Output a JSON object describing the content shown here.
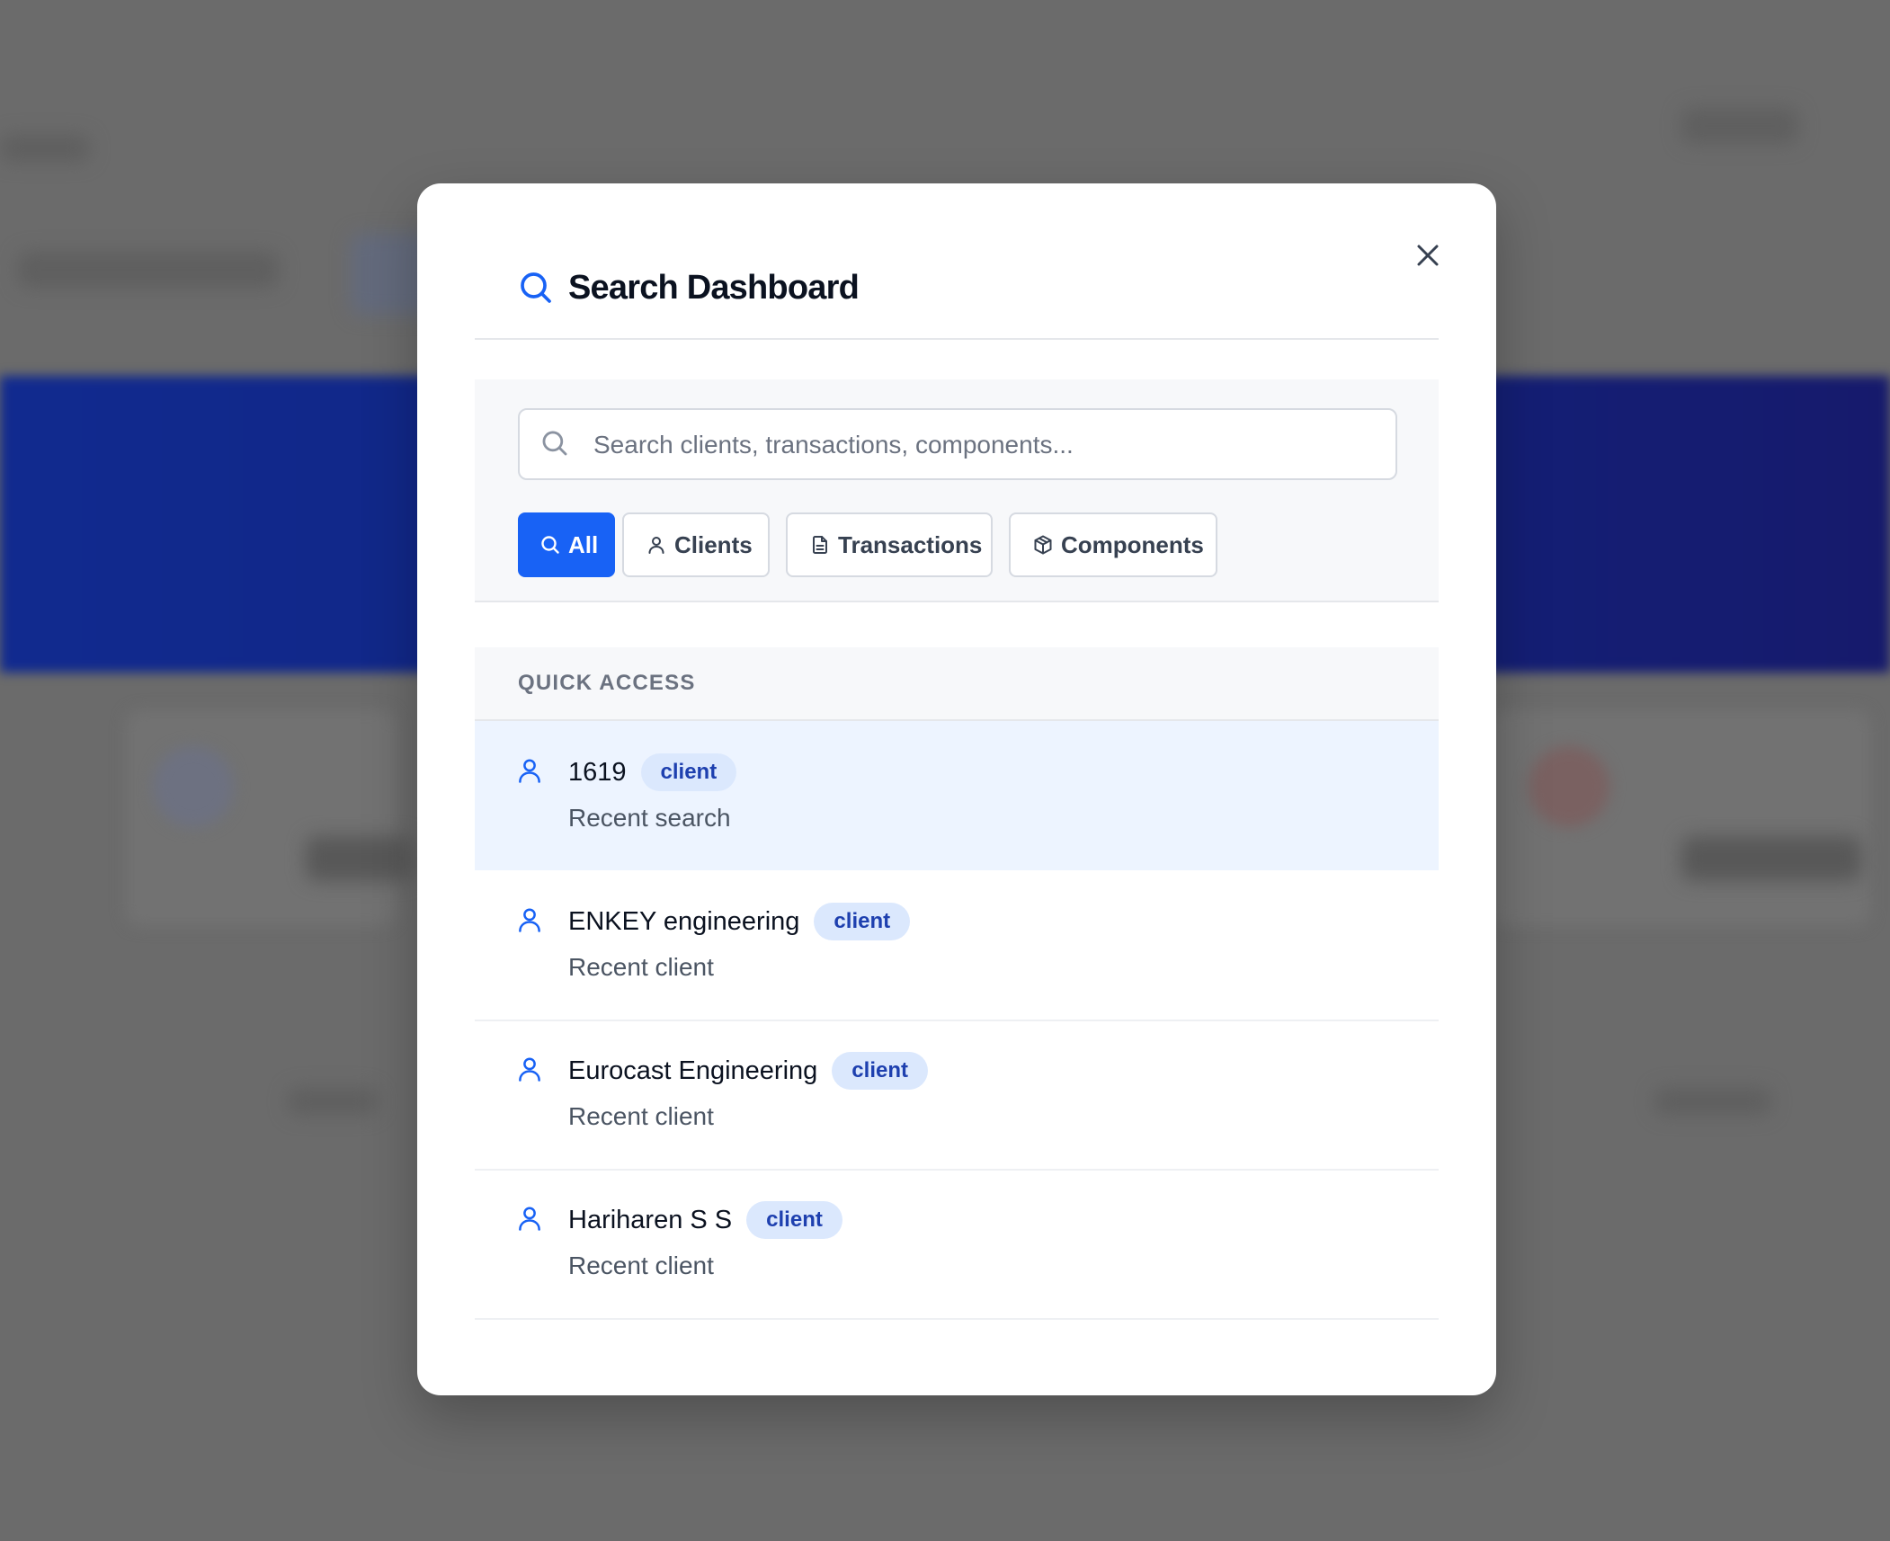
{
  "modal": {
    "title": "Search Dashboard"
  },
  "search": {
    "placeholder": "Search clients, transactions, components...",
    "value": ""
  },
  "filters": [
    {
      "label": "All",
      "icon": "search-icon",
      "active": true
    },
    {
      "label": "Clients",
      "icon": "user-icon",
      "active": false
    },
    {
      "label": "Transactions",
      "icon": "document-icon",
      "active": false
    },
    {
      "label": "Components",
      "icon": "package-icon",
      "active": false
    }
  ],
  "quick_access": {
    "label": "QUICK ACCESS",
    "items": [
      {
        "title": "1619",
        "badge": "client",
        "subtitle": "Recent search",
        "icon": "user-icon",
        "highlighted": true
      },
      {
        "title": "ENKEY engineering",
        "badge": "client",
        "subtitle": "Recent client",
        "icon": "user-icon",
        "highlighted": false
      },
      {
        "title": "Eurocast Engineering",
        "badge": "client",
        "subtitle": "Recent client",
        "icon": "user-icon",
        "highlighted": false
      },
      {
        "title": "Hariharen S S",
        "badge": "client",
        "subtitle": "Recent client",
        "icon": "user-icon",
        "highlighted": false
      }
    ]
  },
  "colors": {
    "accent": "#1862f5",
    "badge_bg": "#dbe8fd",
    "badge_text": "#1e40af",
    "highlight_row": "#edf4ff",
    "overlay": "#6b6b6b"
  }
}
